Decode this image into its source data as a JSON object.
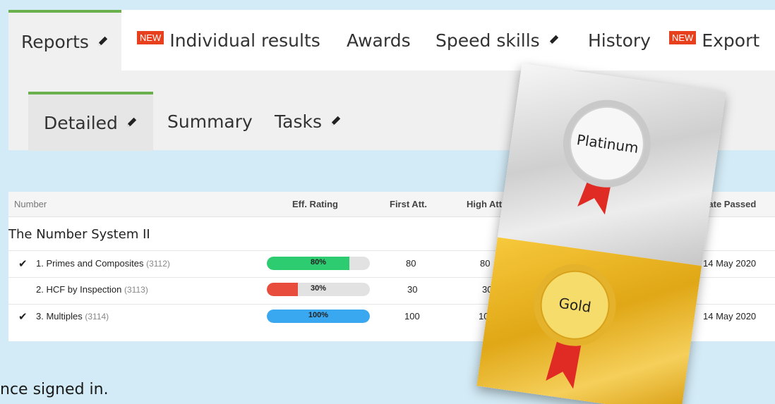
{
  "tabs": [
    {
      "label": "Reports",
      "new": false,
      "edit": true,
      "active": true
    },
    {
      "label": "Individual results",
      "new": true,
      "edit": false,
      "active": false
    },
    {
      "label": "Awards",
      "new": false,
      "edit": false,
      "active": false
    },
    {
      "label": "Speed skills",
      "new": false,
      "edit": true,
      "active": false
    },
    {
      "label": "History",
      "new": false,
      "edit": false,
      "active": false
    },
    {
      "label": "Export",
      "new": true,
      "edit": false,
      "active": false
    }
  ],
  "new_badge": "NEW",
  "subtabs": [
    {
      "label": "Detailed",
      "edit": true,
      "active": true
    },
    {
      "label": "Summary",
      "edit": false,
      "active": false
    },
    {
      "label": "Tasks",
      "edit": true,
      "active": false
    }
  ],
  "table": {
    "headers": {
      "number": "Number",
      "eff_rating": "Eff. Rating",
      "first_att": "First Att.",
      "high_att": "High Att.",
      "date_passed": "Date Passed"
    },
    "group_title": "The Number System II",
    "rows": [
      {
        "done": true,
        "name": "1. Primes and Composites",
        "code": "(3112)",
        "rating": 80,
        "rating_label": "80%",
        "rating_color": "#2ecc71",
        "first": "80",
        "high": "80",
        "date": "14 May 2020"
      },
      {
        "done": false,
        "name": "2. HCF by Inspection",
        "code": "(3113)",
        "rating": 30,
        "rating_label": "30%",
        "rating_color": "#e74c3c",
        "first": "30",
        "high": "30",
        "date": ""
      },
      {
        "done": true,
        "name": "3. Multiples",
        "code": "(3114)",
        "rating": 100,
        "rating_label": "100%",
        "rating_color": "#3aa8f0",
        "first": "100",
        "high": "100",
        "date": "14 May 2020"
      }
    ]
  },
  "award_card": {
    "platinum_label": "Platinum",
    "gold_label": "Gold"
  },
  "footer_text": "nce signed in."
}
